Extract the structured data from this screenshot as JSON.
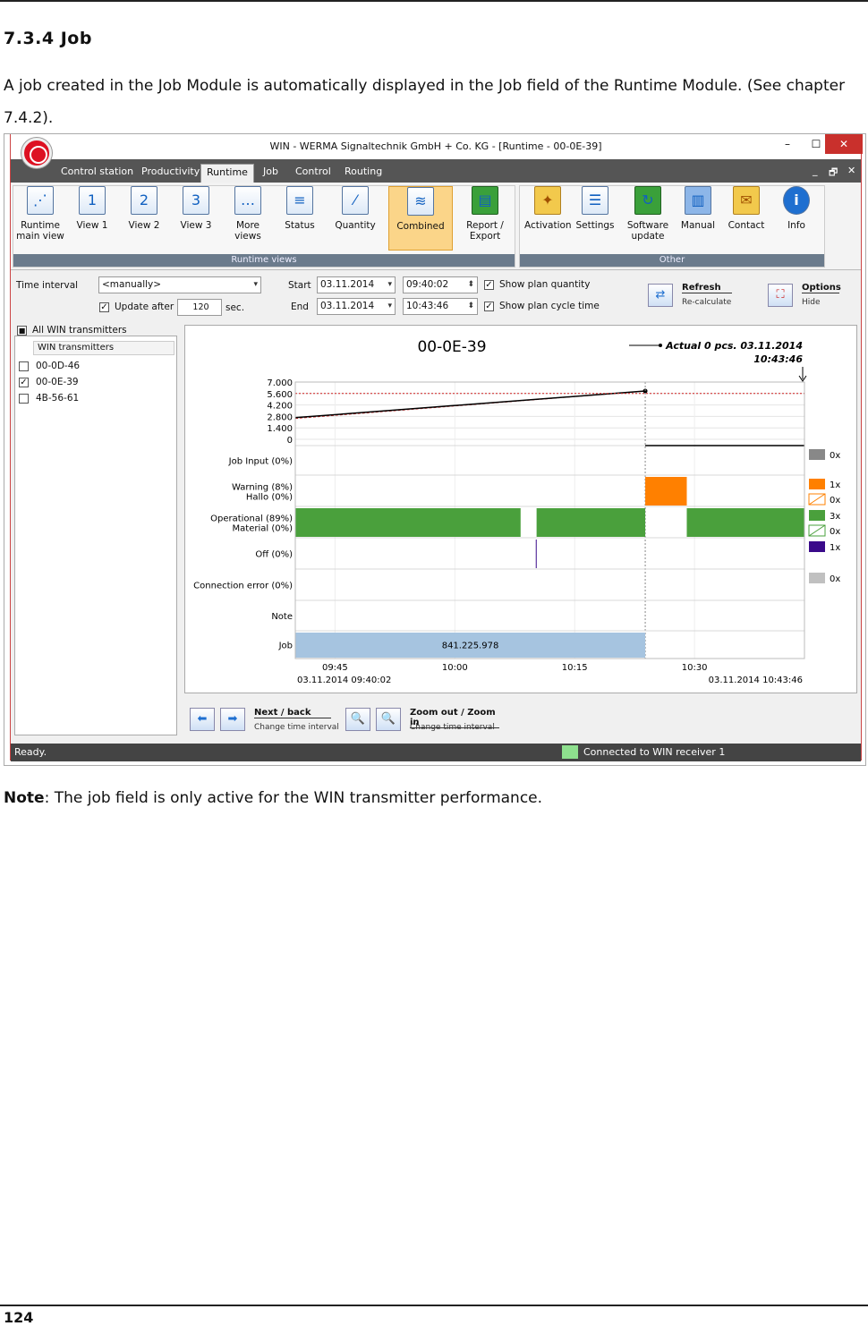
{
  "doc": {
    "heading": "7.3.4  Job",
    "paragraph": "A job created in the Job Module is automatically displayed in the Job field of the Runtime Module. (See chapter 7.4.2).",
    "note_label": "Note",
    "note_text": ": The job field is only active for the WIN transmitter performance.",
    "page_number": "124"
  },
  "window": {
    "title": "WIN - WERMA Signaltechnik GmbH + Co. KG - [Runtime - 00-0E-39]",
    "minimize": "–",
    "maximize": "☐",
    "close": "✕"
  },
  "tabs": [
    "Control station",
    "Productivity",
    "Runtime",
    "Job",
    "Control",
    "Routing"
  ],
  "active_tab": "Runtime",
  "tab_controls": [
    "_",
    "🗗",
    "✕"
  ],
  "ribbon": {
    "group_runtime": "Runtime views",
    "group_other": "Other",
    "buttons": [
      "Runtime main view",
      "View 1",
      "View 2",
      "View 3",
      "More views",
      "Status",
      "Quantity",
      "Combined",
      "Report / Export",
      "Activation",
      "Settings",
      "Software update",
      "Manual",
      "Contact",
      "Info"
    ],
    "icon_glyphs": [
      "⋰",
      "1",
      "2",
      "3",
      "…",
      "≡",
      "⁄",
      "≋",
      "▤",
      "✦",
      "☰",
      "↻",
      "▥",
      "✉",
      "i"
    ]
  },
  "controls": {
    "time_interval_label": "Time interval",
    "time_interval_value": "<manually>",
    "update_after_label": "Update after",
    "update_after_value": "120",
    "sec": "sec.",
    "start_label": "Start",
    "end_label": "End",
    "start_date": "03.11.2014",
    "start_time": "09:40:02",
    "end_date": "03.11.2014",
    "end_time": "10:43:46",
    "show_plan_quantity": "Show plan quantity",
    "show_plan_cycle": "Show plan cycle time",
    "refresh": "Refresh",
    "recalculate": "Re-calculate",
    "options": "Options",
    "hide": "Hide"
  },
  "list": {
    "all_label": "All WIN transmitters",
    "header": "WIN transmitters",
    "items": [
      {
        "name": "00-0D-46",
        "checked": false
      },
      {
        "name": "00-0E-39",
        "checked": true
      },
      {
        "name": "4B-56-61",
        "checked": false
      }
    ]
  },
  "nav": {
    "next_back": "Next / back",
    "change_interval": "Change time interval",
    "zoom": "Zoom out / Zoom in",
    "change_interval2": "Change time interval"
  },
  "status": {
    "ready": "Ready.",
    "connected": "Connected to WIN receiver 1"
  },
  "colors": {
    "operational": "#4aa03c",
    "warning": "#ff8000",
    "off": "#3a0a8a",
    "job_input": "#888888",
    "connection": "#c0c0c0",
    "job": "#a6c4e0",
    "plan_line": "#d02020"
  },
  "chart_data": {
    "type": "timeline",
    "title": "00-0E-39",
    "legend": "Actual 0 pcs.  03.11.2014",
    "legend_time": "10:43:46",
    "yticks": [
      "7.000",
      "5.600",
      "4.200",
      "2.800",
      "1.400",
      "0"
    ],
    "ylim": [
      0,
      7000
    ],
    "xticks": [
      "09:45",
      "10:00",
      "10:15",
      "10:30"
    ],
    "x_start": "03.11.2014 09:40:02",
    "x_end": "03.11.2014 10:43:46",
    "t_range_min": [
      0,
      63.73
    ],
    "tick_minutes": [
      4.97,
      19.97,
      34.97,
      49.97
    ],
    "cursor_min": 43.8,
    "quantity_series": {
      "actual": {
        "t": [
          0,
          43.8
        ],
        "y": [
          2650,
          5900
        ]
      },
      "plan": {
        "t": [
          0,
          43.8
        ],
        "y": [
          2550,
          5900
        ]
      }
    },
    "rows": [
      {
        "label": "Job Input (0%)",
        "count": "0x",
        "color": "#888888",
        "hatched": false,
        "segments": []
      },
      {
        "label": "Warning (8%)",
        "label2": "Hallo (0%)",
        "count": "1x",
        "count2": "0x",
        "color": "#ff8000",
        "hatched": true,
        "segments": [
          [
            43.8,
            49.0
          ]
        ]
      },
      {
        "label": "Operational (89%)",
        "label2": "Material (0%)",
        "count": "3x",
        "count2": "0x",
        "color": "#4aa03c",
        "hatched": true,
        "segments": [
          [
            0,
            28.2
          ],
          [
            30.2,
            43.8
          ],
          [
            49.0,
            63.73
          ]
        ]
      },
      {
        "label": "Off (0%)",
        "count": "1x",
        "color": "#3a0a8a",
        "hatched": false,
        "segments": [
          [
            30.1,
            30.2
          ]
        ]
      },
      {
        "label": "Connection error (0%)",
        "count": "0x",
        "color": "#c0c0c0",
        "hatched": false,
        "segments": []
      },
      {
        "label": "Note",
        "segments": []
      },
      {
        "label": "Job",
        "color": "#a6c4e0",
        "segments": [
          [
            0,
            43.8
          ]
        ],
        "text": "841.225.978"
      }
    ]
  }
}
